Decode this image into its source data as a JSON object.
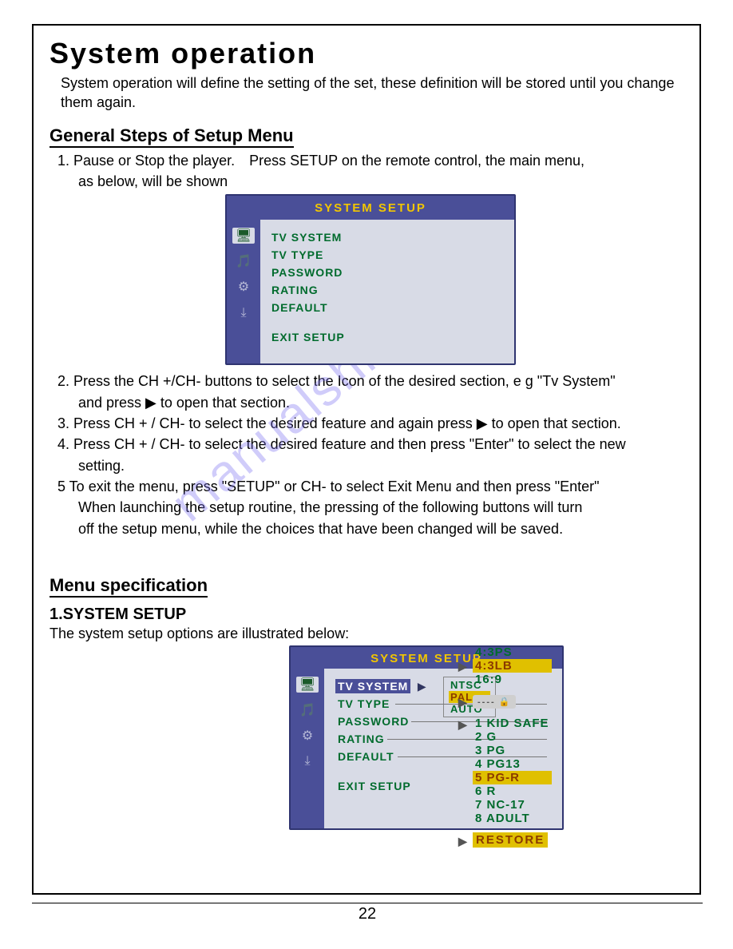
{
  "title": "System operation",
  "intro": "System operation will define the setting of the set, these definition will be stored until you change them again.",
  "h_general": "General Steps of Setup Menu",
  "step1a": "1. Pause or Stop the player. Press SETUP on the remote control, the main menu,",
  "step1b": "as below, will be shown",
  "step2a": "2. Press the CH +/CH- buttons to select the Icon of the desired section, e g \"Tv System\"",
  "step2b": "and press ▶ to open that section.",
  "step3": "3. Press CH + / CH- to select the desired feature and again press ▶ to open that section.",
  "step4a": "4. Press CH + / CH- to select the desired feature and then press \"Enter\" to select the new",
  "step4b": "setting.",
  "step5a": "5 To exit the menu, press \"SETUP\" or CH- to select Exit Menu and then press \"Enter\"",
  "step5b": "When launching the setup routine, the pressing of the following buttons will turn",
  "step5c": "off the setup menu, while the choices that have been changed will be saved.",
  "h_menu": "Menu specification",
  "h_sys": "1.SYSTEM SETUP",
  "sys_text": "The system setup options are illustrated  below:",
  "osd": {
    "header": "SYSTEM SETUP",
    "items": {
      "tv_system": "TV SYSTEM",
      "tv_type": "TV TYPE",
      "password": "PASSWORD",
      "rating": "RATING",
      "default": "DEFAULT",
      "exit": "EXIT SETUP"
    },
    "tv_system_sub": {
      "ntsc": "NTSC",
      "pal": "PAL",
      "auto": "AUTO"
    }
  },
  "tv_type_opts": {
    "a": "4:3PS",
    "b": "4:3LB",
    "c": "16:9"
  },
  "pw_box": "---- ",
  "rating_opts": {
    "r1": "1 KID SAFE",
    "r2": "2 G",
    "r3": "3 PG",
    "r4": "4 PG13",
    "r5": "5 PG-R",
    "r6": "6 R",
    "r7": "7 NC-17",
    "r8": "8 ADULT"
  },
  "restore": "RESTORE",
  "page_number": "22",
  "watermark": "manualshive.com"
}
